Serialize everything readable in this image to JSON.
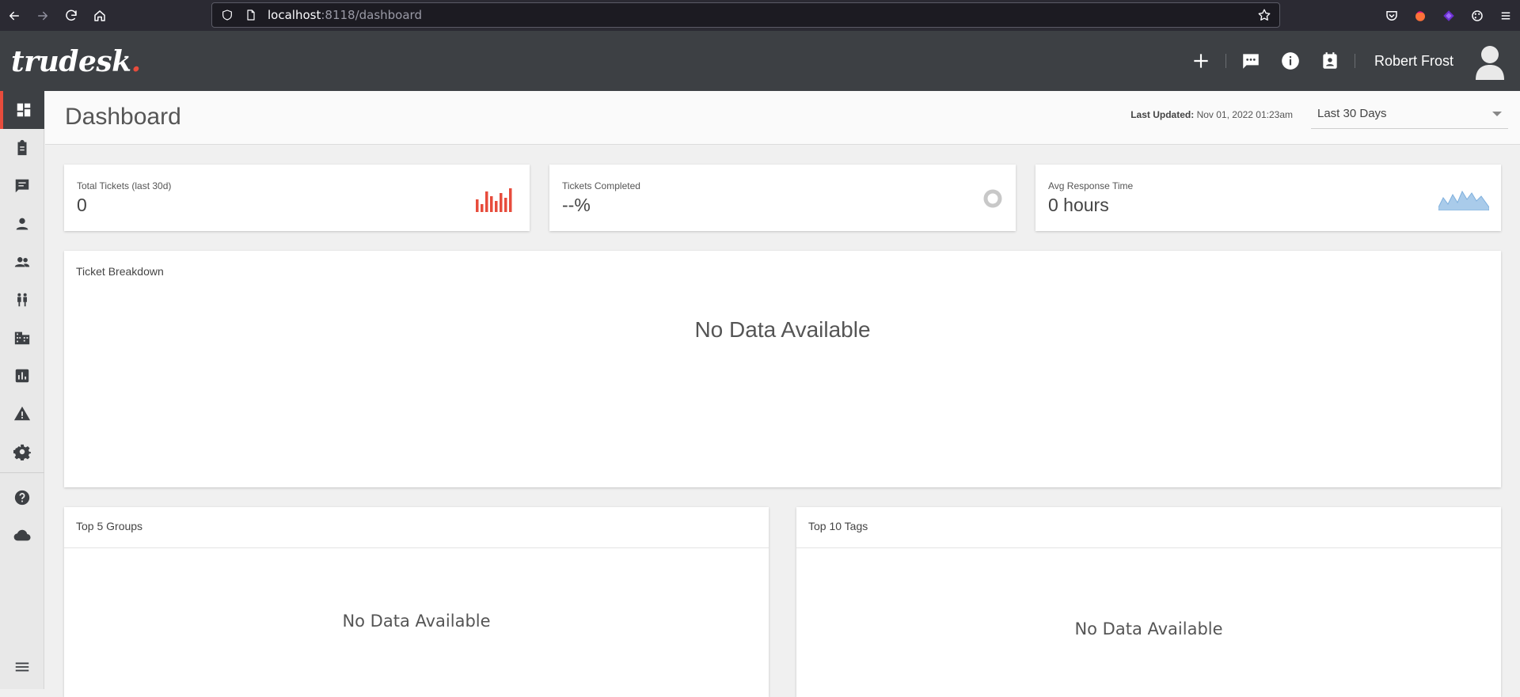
{
  "browser": {
    "url_host": "localhost",
    "url_path": ":8118/dashboard"
  },
  "header": {
    "logo_text": "trudesk",
    "logo_dot": ".",
    "icons": [
      "plus-icon",
      "chat-icon",
      "info-icon",
      "contact-card-icon"
    ],
    "username": "Robert Frost"
  },
  "sidebar": {
    "items": [
      {
        "icon": "dashboard-icon",
        "active": true
      },
      {
        "icon": "tickets-icon"
      },
      {
        "icon": "messages-icon"
      },
      {
        "icon": "accounts-icon"
      },
      {
        "icon": "groups-icon"
      },
      {
        "icon": "teams-icon"
      },
      {
        "icon": "departments-icon"
      },
      {
        "icon": "reports-icon"
      },
      {
        "icon": "notices-icon"
      },
      {
        "icon": "settings-icon"
      },
      {
        "icon": "help-icon"
      },
      {
        "icon": "cloud-icon"
      },
      {
        "icon": "menu-icon"
      }
    ]
  },
  "page": {
    "title": "Dashboard",
    "last_updated_label": "Last Updated:",
    "last_updated_value": "Nov 01, 2022 01:23am",
    "range_selected": "Last 30 Days"
  },
  "stats": [
    {
      "label": "Total Tickets (last 30d)",
      "value": "0",
      "icon": "bar-spark-icon"
    },
    {
      "label": "Tickets Completed",
      "value": "--%",
      "icon": "donut-icon"
    },
    {
      "label": "Avg Response Time",
      "value": "0 hours",
      "icon": "area-spark-icon"
    }
  ],
  "breakdown": {
    "title": "Ticket Breakdown",
    "empty": "No Data Available"
  },
  "top_groups": {
    "title": "Top 5 Groups",
    "empty": "No Data Available"
  },
  "top_tags": {
    "title": "Top 10 Tags",
    "empty": "No Data Available"
  },
  "colors": {
    "header_bg": "#3d4044",
    "accent": "#e74c3c",
    "spark_blue": "#a9cbea"
  }
}
